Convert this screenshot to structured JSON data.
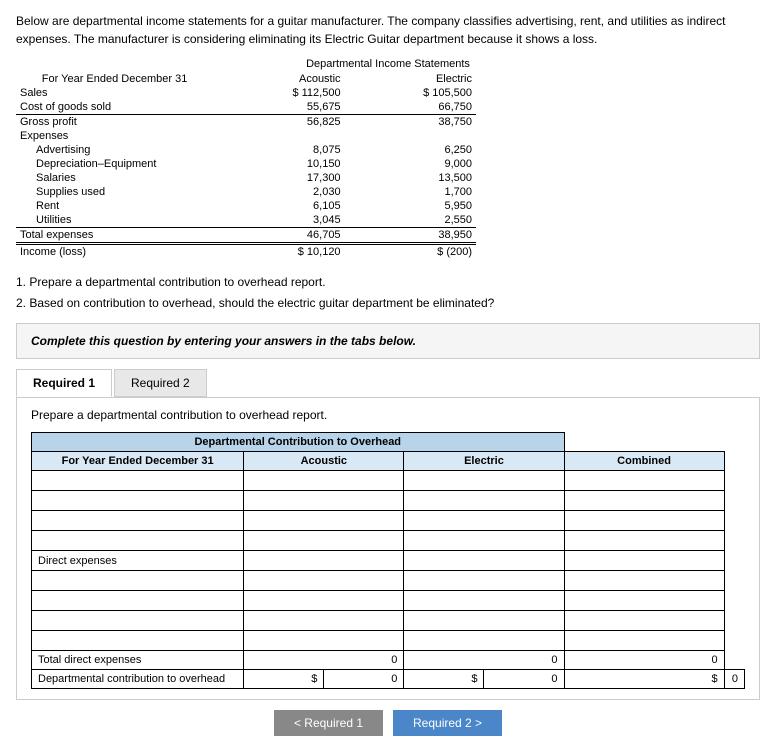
{
  "intro": {
    "text": "Below are departmental income statements for a guitar manufacturer. The company classifies advertising, rent, and utilities as indirect expenses. The manufacturer is considering eliminating its Electric Guitar department because it shows a loss."
  },
  "income_statement": {
    "title1": "Departmental Income Statements",
    "title2": "For Year Ended December 31",
    "col_acoustic": "Acoustic",
    "col_electric": "Electric",
    "rows": [
      {
        "label": "Sales",
        "acoustic": "$ 112,500",
        "electric": "$ 105,500"
      },
      {
        "label": "Cost of goods sold",
        "acoustic": "55,675",
        "electric": "66,750"
      },
      {
        "label": "Gross profit",
        "acoustic": "56,825",
        "electric": "38,750"
      },
      {
        "label": "Expenses",
        "acoustic": "",
        "electric": ""
      },
      {
        "label": "Advertising",
        "acoustic": "8,075",
        "electric": "6,250",
        "indent": true
      },
      {
        "label": "Depreciation–Equipment",
        "acoustic": "10,150",
        "electric": "9,000",
        "indent": true
      },
      {
        "label": "Salaries",
        "acoustic": "17,300",
        "electric": "13,500",
        "indent": true
      },
      {
        "label": "Supplies used",
        "acoustic": "2,030",
        "electric": "1,700",
        "indent": true
      },
      {
        "label": "Rent",
        "acoustic": "6,105",
        "electric": "5,950",
        "indent": true
      },
      {
        "label": "Utilities",
        "acoustic": "3,045",
        "electric": "2,550",
        "indent": true
      },
      {
        "label": "Total expenses",
        "acoustic": "46,705",
        "electric": "38,950"
      },
      {
        "label": "Income (loss)",
        "acoustic": "$ 10,120",
        "electric": "$ (200)"
      }
    ]
  },
  "questions": {
    "q1": "1. Prepare a departmental contribution to overhead report.",
    "q2": "2. Based on contribution to overhead, should the electric guitar department be eliminated?"
  },
  "complete_box": {
    "text": "Complete this question by entering your answers in the tabs below."
  },
  "tabs": {
    "tab1": "Required 1",
    "tab2": "Required 2",
    "active": 0
  },
  "tab1_content": {
    "prepare_label": "Prepare a departmental contribution to overhead report.",
    "table": {
      "title": "Departmental Contribution to Overhead",
      "col1": "For Year Ended December 31",
      "col2": "Acoustic",
      "col3": "Electric",
      "col4": "Combined",
      "rows": [
        {
          "label": "",
          "acoustic": "",
          "electric": "",
          "combined": ""
        },
        {
          "label": "",
          "acoustic": "",
          "electric": "",
          "combined": ""
        },
        {
          "label": "",
          "acoustic": "",
          "electric": "",
          "combined": ""
        },
        {
          "label": "",
          "acoustic": "",
          "electric": "",
          "combined": ""
        },
        {
          "label": "Direct expenses",
          "acoustic": "",
          "electric": "",
          "combined": ""
        },
        {
          "label": "",
          "acoustic": "",
          "electric": "",
          "combined": ""
        },
        {
          "label": "",
          "acoustic": "",
          "electric": "",
          "combined": ""
        },
        {
          "label": "",
          "acoustic": "",
          "electric": "",
          "combined": ""
        },
        {
          "label": "",
          "acoustic": "",
          "electric": "",
          "combined": ""
        },
        {
          "label": "Total direct expenses",
          "acoustic": "0",
          "electric": "0",
          "combined": "0"
        },
        {
          "label": "Departmental contribution to overhead",
          "acoustic_prefix": "$",
          "acoustic": "0",
          "electric_prefix": "$",
          "electric": "0",
          "combined_prefix": "$",
          "combined": "0"
        }
      ]
    }
  },
  "nav": {
    "prev_label": "< Required 1",
    "next_label": "Required 2 >"
  }
}
